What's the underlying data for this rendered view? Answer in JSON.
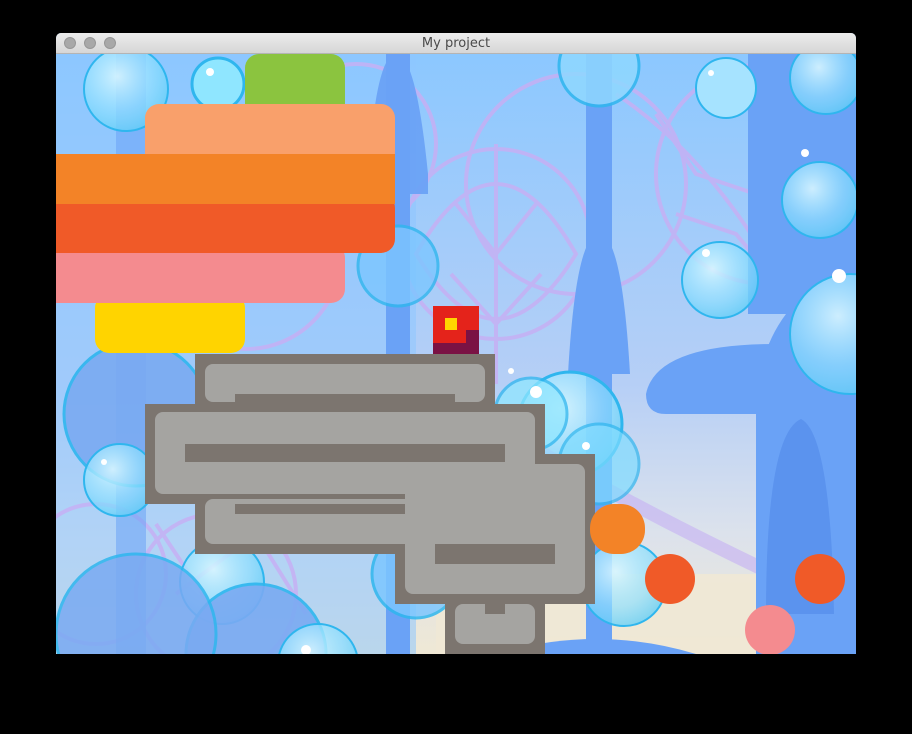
{
  "window": {
    "title": "My project",
    "controls": [
      "close-button",
      "minimize-button",
      "zoom-button"
    ]
  },
  "colors": {
    "sky": "#8cc6ff",
    "tree_trunk": "#6aa2f6",
    "leaf_line": "#c6b0f4",
    "bubble": "#7fdcff",
    "bubble_edge": "#2fb6ee",
    "ground": "#efe8d5",
    "stone_dark": "#7c756f",
    "stone_light": "#a5a4a1",
    "player_red": "#e4231b",
    "player_dark": "#7a1244",
    "player_eye": "#ffd600",
    "stack_peach": "#f9a06b",
    "stack_orange": "#f38327",
    "stack_redorange": "#f05a28",
    "stack_pink": "#f48b8f",
    "stack_yellow": "#ffd400",
    "stack_green": "#8bc43f",
    "dot_orange": "#f05a28",
    "dot_pink": "#f48b8f"
  },
  "scene": {
    "player": "red-square-character",
    "platform": "gray-stone-maze-platform",
    "blocks": [
      "green-block",
      "peach-block",
      "orange-block",
      "red-orange-block",
      "pink-block",
      "yellow-block"
    ],
    "pickups": [
      "orange-capsule",
      "orange-dot",
      "orange-dot",
      "pink-dot"
    ]
  }
}
